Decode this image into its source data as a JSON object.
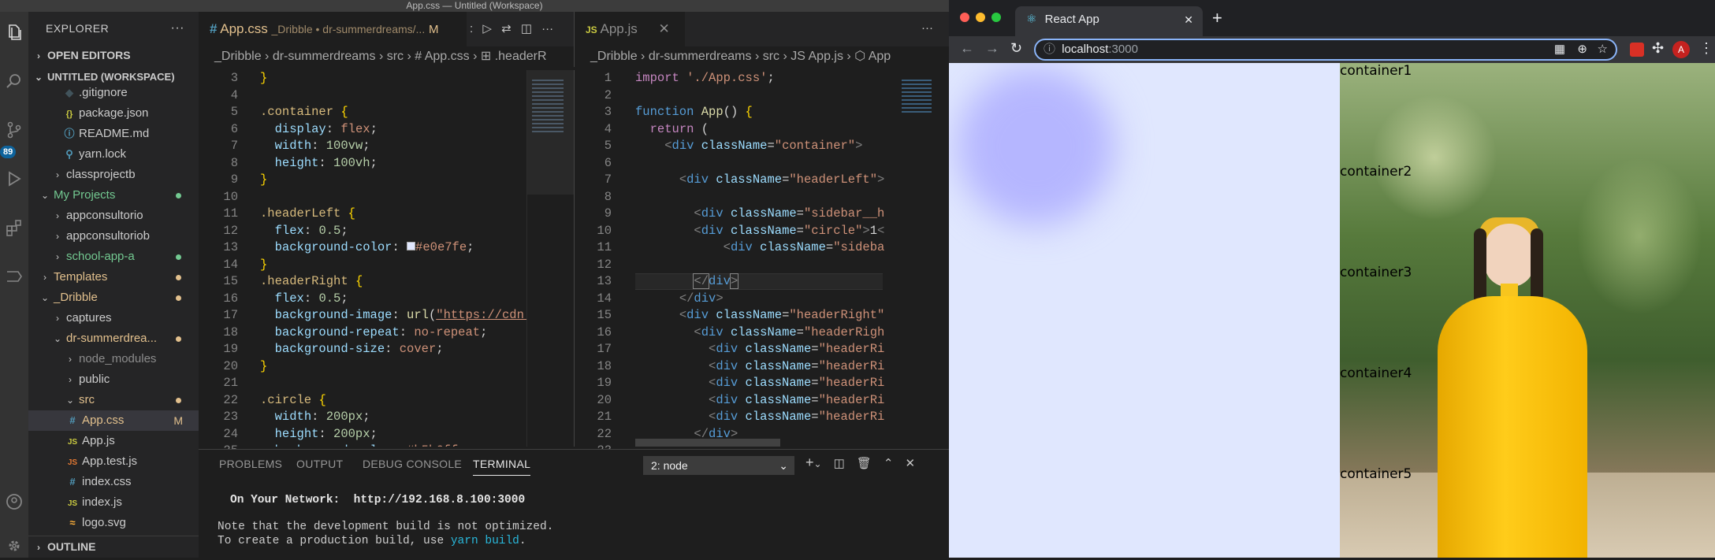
{
  "window_title": "App.css — Untitled (Workspace)",
  "activity": {
    "badge": "89"
  },
  "explorer": {
    "title": "EXPLORER",
    "open_editors": "OPEN EDITORS",
    "workspace": "UNTITLED (WORKSPACE)",
    "items": [
      {
        "label": ".gitignore",
        "icon": "◆"
      },
      {
        "label": "package.json",
        "icon": "{}"
      },
      {
        "label": "README.md",
        "icon": "ⓘ"
      },
      {
        "label": "yarn.lock",
        "icon": "⚲"
      },
      {
        "label": "classprojectb"
      },
      {
        "label": "My Projects"
      },
      {
        "label": "appconsultorio"
      },
      {
        "label": "appconsultoriob"
      },
      {
        "label": "school-app-a"
      },
      {
        "label": "Templates"
      },
      {
        "label": "_Dribble"
      },
      {
        "label": "captures"
      },
      {
        "label": "dr-summerdrea..."
      },
      {
        "label": "node_modules"
      },
      {
        "label": "public"
      },
      {
        "label": "src"
      },
      {
        "label": "App.css",
        "icon": "#",
        "badge": "M"
      },
      {
        "label": "App.js",
        "icon": "JS"
      },
      {
        "label": "App.test.js",
        "icon": "JS"
      },
      {
        "label": "index.css",
        "icon": "#"
      },
      {
        "label": "index.js",
        "icon": "JS"
      },
      {
        "label": "logo.svg",
        "icon": "≈"
      }
    ],
    "outline": "OUTLINE"
  },
  "editor1": {
    "tab_name": "App.css",
    "tab_path": "_Dribble • dr-summerdreams/...",
    "tab_badge": "M",
    "breadcrumb": [
      "_Dribble",
      "dr-summerdreams",
      "src",
      "# App.css",
      "⊞ .headerR"
    ],
    "line_numbers": "3\n4\n5\n6\n7\n8\n9\n10\n11\n12\n13\n14\n15\n16\n17\n18\n19\n20\n21\n22\n23\n24\n25"
  },
  "editor2": {
    "tab_name": "App.js",
    "breadcrumb": [
      "_Dribble",
      "dr-summerdreams",
      "src",
      "JS App.js",
      "⬡ App"
    ],
    "line_numbers": "1\n2\n3\n4\n5\n6\n7\n8\n9\n10\n11\n12\n13\n14\n15\n16\n17\n18\n19\n20\n21\n22\n23"
  },
  "panel": {
    "tabs": [
      "PROBLEMS",
      "OUTPUT",
      "DEBUG CONSOLE",
      "TERMINAL"
    ],
    "terminal_select": "2: node",
    "lines": [
      "On Your Network:  http://192.168.8.100:3000",
      "Note that the development build is not optimized.",
      "To create a production build, use ",
      "yarn build",
      "."
    ]
  },
  "browser": {
    "tab_title": "React App",
    "url": "localhost",
    "url_port": ":3000",
    "avatar": "A",
    "containers": [
      "container1",
      "container2",
      "container3",
      "container4",
      "container5"
    ]
  },
  "colors": {
    "header_left": "#e0e7fe",
    "accent": "#007acc"
  }
}
